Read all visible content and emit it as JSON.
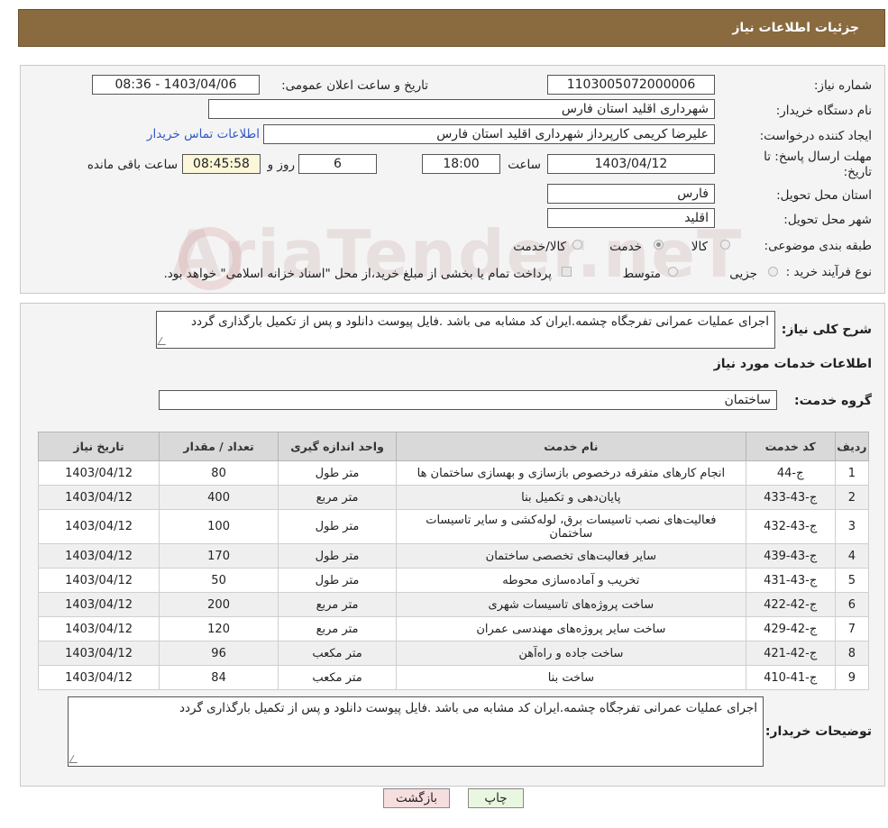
{
  "header": {
    "title": "جزئیات اطلاعات نیاز"
  },
  "details": {
    "need_number_label": "شماره نیاز:",
    "need_number": "1103005072000006",
    "announce_label": "تاریخ و ساعت اعلان عمومی:",
    "announce_value": "1403/04/06 - 08:36",
    "buyer_org_label": "نام دستگاه خریدار:",
    "buyer_org": "شهرداری اقلید استان فارس",
    "creator_label": "ایجاد کننده درخواست:",
    "creator": "علیرضا کریمی  کارپرداز شهرداری اقلید استان فارس",
    "contact_link": "اطلاعات تماس خریدار",
    "deadline_label_line1": "مهلت ارسال پاسخ: تا",
    "deadline_label_line2": "تاریخ:",
    "deadline_date": "1403/04/12",
    "time_label": "ساعت",
    "deadline_time": "18:00",
    "days_value": "6",
    "days_label": "روز و",
    "remaining_time": "08:45:58",
    "remaining_label": "ساعت باقی مانده",
    "province_label": "استان محل تحویل:",
    "province": "فارس",
    "city_label": "شهر محل تحویل:",
    "city": "اقلید",
    "category_label": "طبقه بندی موضوعی:",
    "category_options": [
      "کالا",
      "خدمت",
      "کالا/خدمت"
    ],
    "purchase_type_label": "نوع فرآیند خرید :",
    "purchase_options": [
      "جزیی",
      "متوسط"
    ],
    "payment_note": "پرداخت تمام یا بخشی از مبلغ خرید،از محل \"اسناد خزانه اسلامی\" خواهد بود."
  },
  "summary": {
    "label": "شرح کلی نیاز:",
    "text": "اجرای عملیات عمرانی تفرجگاه چشمه.ایران کد مشابه می باشد .فایل پیوست دانلود و پس از تکمیل بارگذاری گردد",
    "services_title": "اطلاعات خدمات مورد نیاز",
    "group_label": "گروه خدمت:",
    "group_value": "ساختمان"
  },
  "table": {
    "headers": [
      "ردیف",
      "کد خدمت",
      "نام خدمت",
      "واحد اندازه گیری",
      "تعداد / مقدار",
      "تاریخ نیاز"
    ],
    "rows": [
      [
        "1",
        "ج-44",
        "انجام کارهای متفرقه درخصوص بازسازی و بهسازی ساختمان ها",
        "متر طول",
        "80",
        "1403/04/12"
      ],
      [
        "2",
        "ج-43-433",
        "پایان‌دهی و تکمیل بنا",
        "متر مربع",
        "400",
        "1403/04/12"
      ],
      [
        "3",
        "ج-43-432",
        "فعالیت‌های نصب تاسیسات برق، لوله‌کشی و سایر تاسیسات ساختمان",
        "متر طول",
        "100",
        "1403/04/12"
      ],
      [
        "4",
        "ج-43-439",
        "سایر فعالیت‌های تخصصی ساختمان",
        "متر طول",
        "170",
        "1403/04/12"
      ],
      [
        "5",
        "ج-43-431",
        "تخریب و آماده‌سازی محوطه",
        "متر طول",
        "50",
        "1403/04/12"
      ],
      [
        "6",
        "ج-42-422",
        "ساخت پروژه‌های تاسیسات شهری",
        "متر مربع",
        "200",
        "1403/04/12"
      ],
      [
        "7",
        "ج-42-429",
        "ساخت سایر پروژه‌های مهندسی عمران",
        "متر مربع",
        "120",
        "1403/04/12"
      ],
      [
        "8",
        "ج-42-421",
        "ساخت جاده و راه‌آهن",
        "متر مکعب",
        "96",
        "1403/04/12"
      ],
      [
        "9",
        "ج-41-410",
        "ساخت بنا",
        "متر مکعب",
        "84",
        "1403/04/12"
      ]
    ]
  },
  "buyer_notes": {
    "label": "توضیحات خریدار:",
    "text": "اجرای عملیات عمرانی تفرجگاه چشمه.ایران کد مشابه می باشد .فایل پیوست دانلود و پس از تکمیل بارگذاری گردد"
  },
  "buttons": {
    "print": "چاپ",
    "back": "بازگشت"
  },
  "watermark": "AriaTender.neT"
}
